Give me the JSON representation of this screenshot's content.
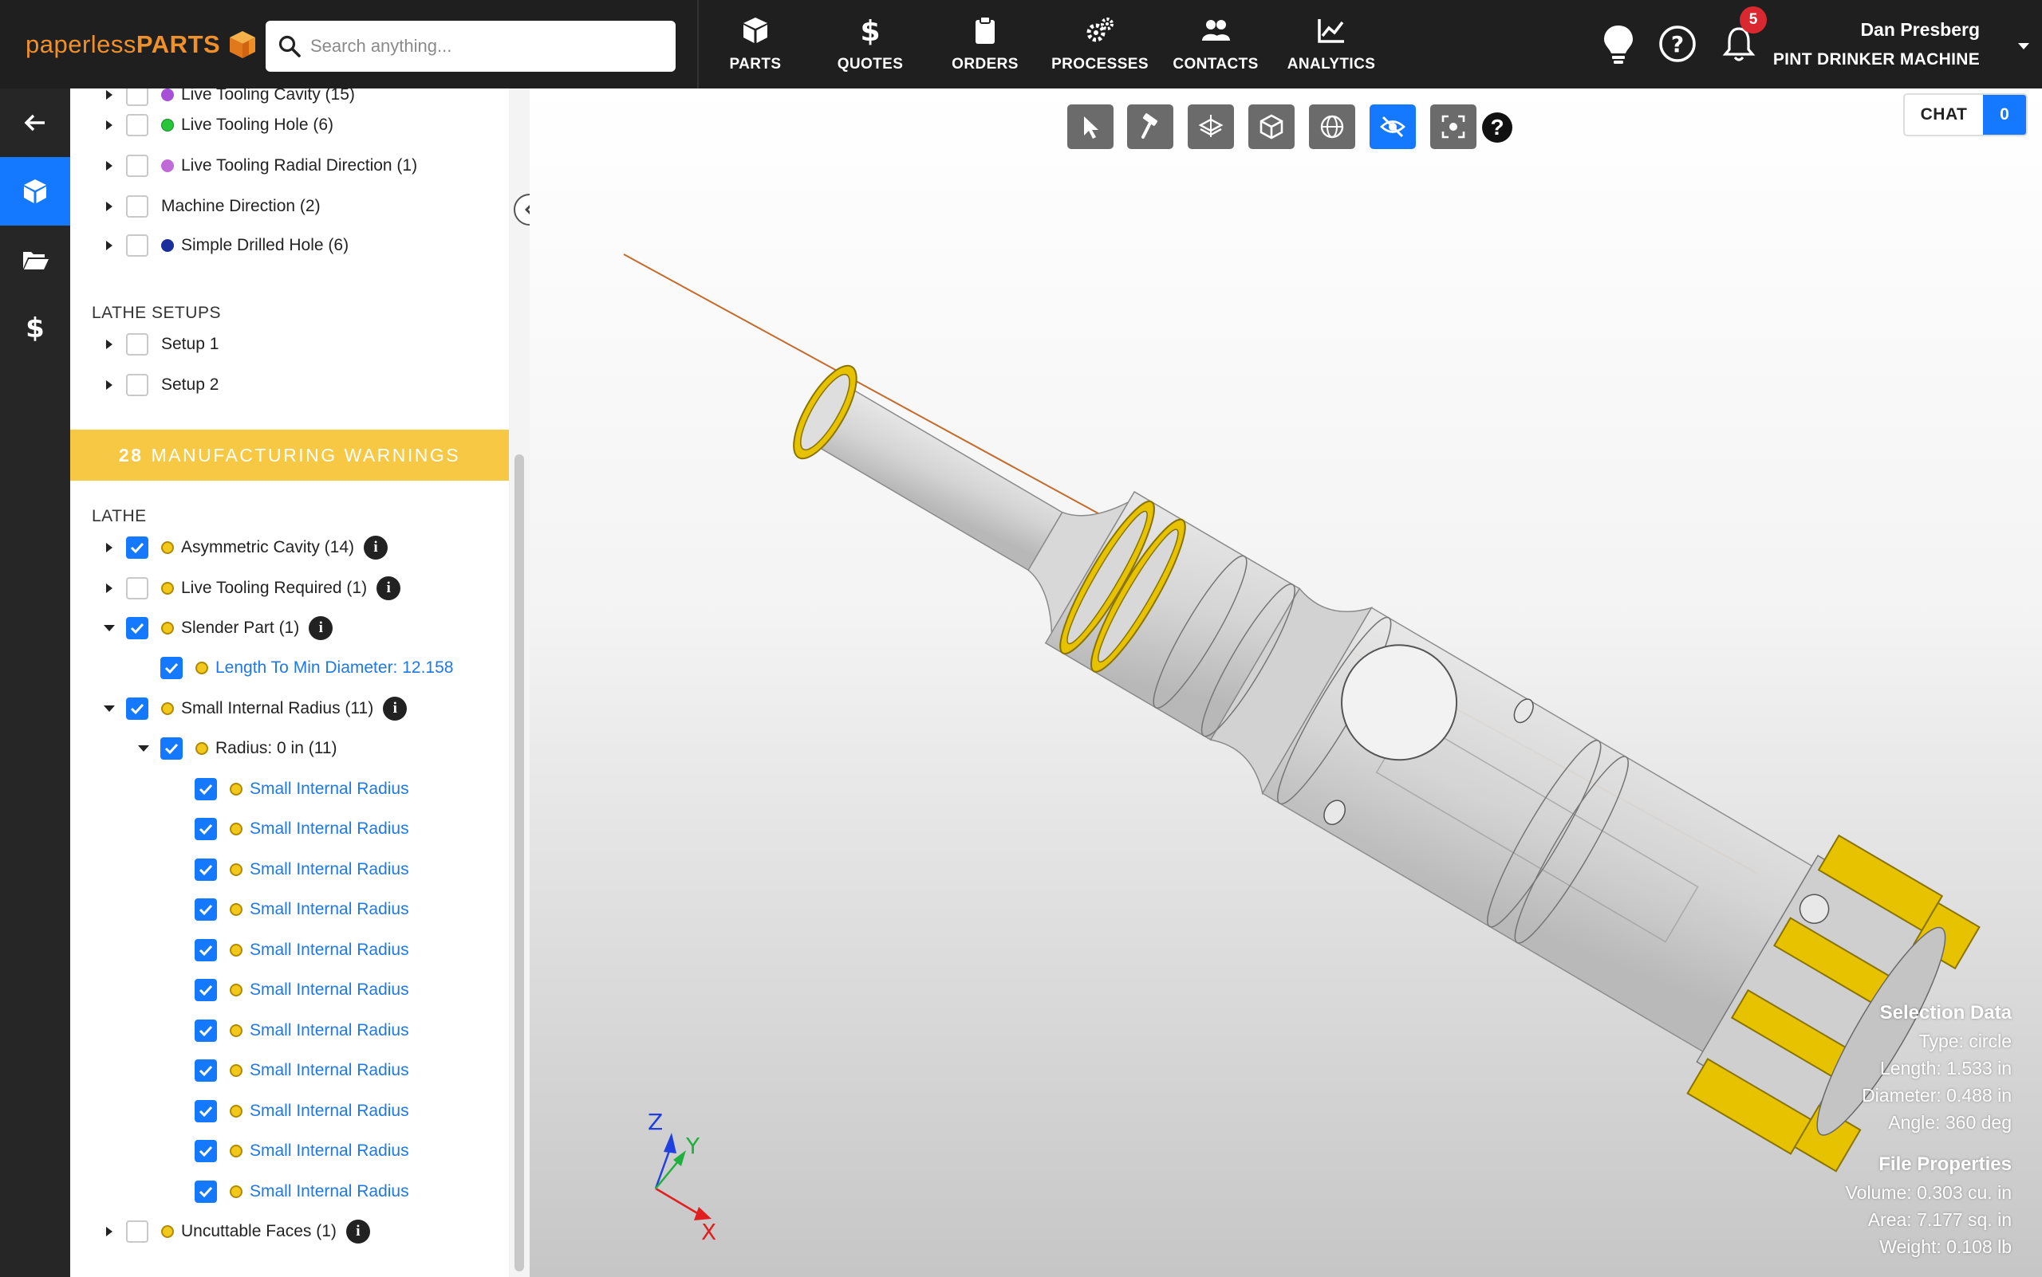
{
  "brand": {
    "name_light": "paperless",
    "name_bold": "PARTS"
  },
  "search": {
    "placeholder": "Search anything..."
  },
  "nav": [
    {
      "label": "PARTS",
      "icon": "cube-icon"
    },
    {
      "label": "QUOTES",
      "icon": "dollar-icon"
    },
    {
      "label": "ORDERS",
      "icon": "clipboard-icon"
    },
    {
      "label": "PROCESSES",
      "icon": "gears-icon"
    },
    {
      "label": "CONTACTS",
      "icon": "people-icon"
    },
    {
      "label": "ANALYTICS",
      "icon": "chart-line-icon"
    }
  ],
  "notifications": {
    "count": "5"
  },
  "user": {
    "name": "Dan Presberg",
    "org": "PINT DRINKER MACHINE"
  },
  "rail": {
    "active": "parts",
    "icons": [
      "arrow-left-icon",
      "cube-icon",
      "folder-open-icon",
      "dollar-icon"
    ]
  },
  "features": [
    {
      "label": "Live Tooling Cavity (15)",
      "color": "#a550d6"
    },
    {
      "label": "Live Tooling Hole (6)",
      "color": "#27c53a"
    },
    {
      "label": "Live Tooling Radial Direction (1)",
      "color": "#c06ad8"
    },
    {
      "label": "Machine Direction (2)",
      "color": ""
    },
    {
      "label": "Simple Drilled Hole (6)",
      "color": "#1a2f9a"
    }
  ],
  "lathe_setups": {
    "title": "LATHE SETUPS",
    "items": [
      "Setup 1",
      "Setup 2"
    ]
  },
  "warnings": {
    "count": "28",
    "label": "MANUFACTURING WARNINGS",
    "group": "LATHE",
    "items": {
      "asymmetric": "Asymmetric Cavity (14)",
      "live_tooling": "Live Tooling Required (1)",
      "slender": "Slender Part (1)",
      "slender_child": "Length To Min Diameter: 12.158",
      "small_radius": "Small Internal Radius (11)",
      "radius_group": "Radius: 0 in (11)",
      "radius_child": "Small Internal Radius",
      "uncuttable": "Uncuttable Faces (1)"
    }
  },
  "viewer": {
    "chat_label": "CHAT",
    "chat_count": "0",
    "help": "?",
    "axis": {
      "x": "X",
      "y": "Y",
      "z": "Z"
    },
    "tools": [
      "cursor-icon",
      "hammer-icon",
      "layers-icon",
      "box-icon",
      "globe-icon",
      "eye-slash-icon",
      "fit-view-icon"
    ]
  },
  "selection": {
    "title": "Selection Data",
    "type": "Type:  circle",
    "length": "Length:  1.533 in",
    "diameter": "Diameter:  0.488 in",
    "angle": "Angle:  360 deg"
  },
  "file_props": {
    "title": "File Properties",
    "volume": "Volume: 0.303 cu. in",
    "area": "Area: 7.177 sq. in",
    "weight": "Weight: 0.108 lb"
  }
}
